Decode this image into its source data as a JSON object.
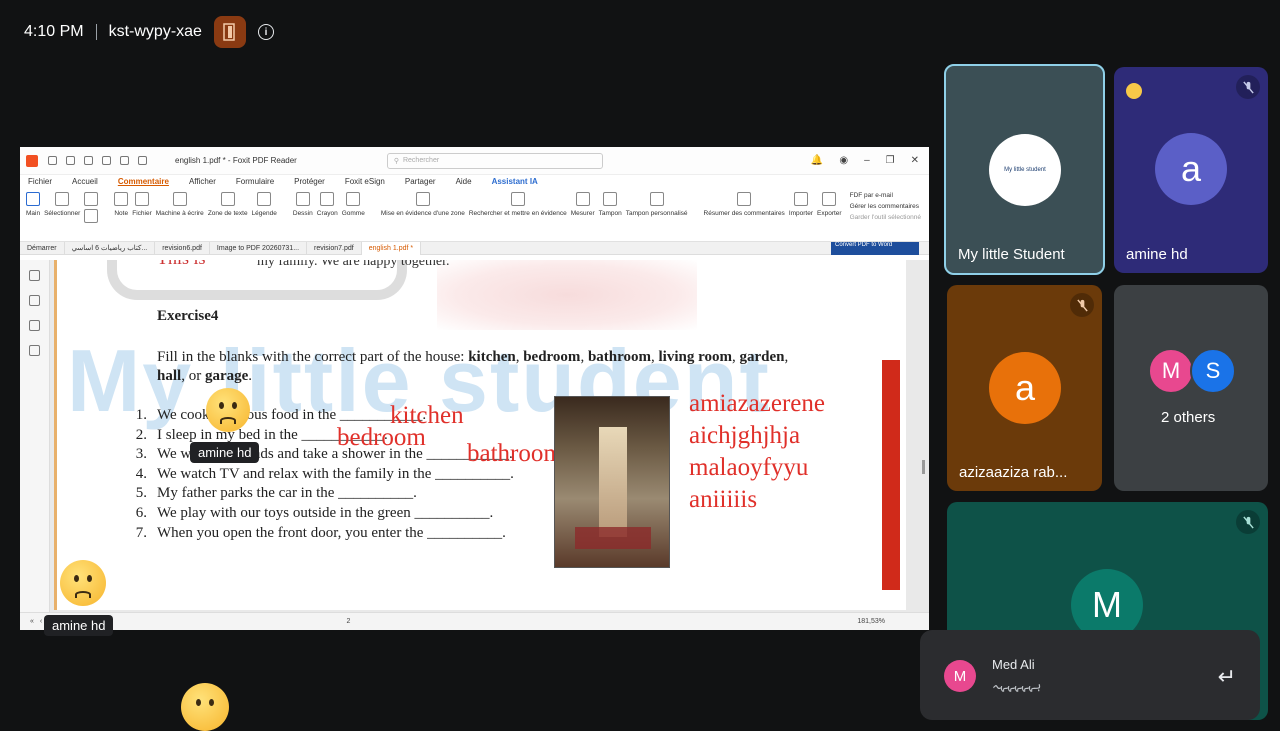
{
  "topbar": {
    "time": "4:10 PM",
    "meeting_code": "kst-wypy-xae",
    "door_icon": "door-icon",
    "info_icon": "info-icon"
  },
  "pdf_app": {
    "window_title": "english 1.pdf * - Foxit PDF Reader",
    "search_placeholder": "Rechercher",
    "menu": [
      "Fichier",
      "Accueil",
      "Commentaire",
      "Afficher",
      "Formulaire",
      "Protéger",
      "Foxit eSign",
      "Partager",
      "Aide",
      "Assistant IA"
    ],
    "active_menu": "Commentaire",
    "ribbon": {
      "main": "Main",
      "select": "Sélectionner",
      "note": "Note",
      "file": "Fichier",
      "typewriter": "Machine à écrire",
      "textbox": "Zone de texte",
      "legend": "Légende",
      "draw": "Dessin",
      "pencil": "Crayon",
      "eraser": "Gomme",
      "highlight_area": "Mise en évidence d'une zone",
      "search_highlight": "Rechercher et mettre en évidence",
      "measure": "Mesurer",
      "stamp": "Tampon",
      "custom_stamp": "Tampon personnalisé",
      "summarize": "Résumer des commentaires",
      "import": "Importer",
      "export": "Exporter",
      "fdf_email": "FDF par e-mail",
      "manage_comments": "Gérer les commentaires",
      "keep_tool": "Garder l'outil sélectionné"
    },
    "tabs": [
      "Démarrer",
      "كتاب رياضيات 6 اساسي...",
      "revision6.pdf",
      "Image to PDF 20260731...",
      "revision7.pdf",
      "english 1.pdf *"
    ],
    "current_tab": "english 1.pdf *",
    "convert_button": "Convert PDF to Word",
    "zoom": "181,53%",
    "page_number": "2"
  },
  "document": {
    "cut_line": "This is",
    "cut_line_rest": "my family. We are happy together.",
    "watermark": "My little student",
    "exercise_title": "Exercise4",
    "instructions_plain": "Fill in the blanks with the correct part of the house: ",
    "instructions_bold": [
      "kitchen",
      "bedroom",
      "bathroom",
      "living room",
      "garden",
      "hall"
    ],
    "instructions_tail_or": "or",
    "instructions_last": "garage",
    "items": [
      {
        "n": "1.",
        "text": "We cook delicious food in the ___________."
      },
      {
        "n": "2.",
        "text": "I sleep in my bed in the ___________."
      },
      {
        "n": "3.",
        "text": "We wash our hands and take a shower in the ___________."
      },
      {
        "n": "4.",
        "text": "We watch TV and relax with the family in the __________."
      },
      {
        "n": "5.",
        "text": "My father parks the car in the __________."
      },
      {
        "n": "6.",
        "text": "We play with our toys outside in the green __________."
      },
      {
        "n": "7.",
        "text": "When you open the front door, you enter the __________."
      }
    ],
    "answers": [
      "kitchen",
      "bedroom",
      "bathroom"
    ],
    "scribbles": [
      "amiazazerene",
      "aichjghjhja",
      "malaoyfyyu",
      "aniiiiis"
    ]
  },
  "reactions": {
    "tooltip_name_1": "amine hd",
    "tooltip_name_2": "amine hd"
  },
  "participants": [
    {
      "name": "My little Student",
      "avatar_text": "My little student",
      "color": "#3b4f55",
      "muted": false
    },
    {
      "name": "amine hd",
      "avatar_letter": "a",
      "color": "#5b5fc7",
      "muted": true
    },
    {
      "name": "azizaaziza rab...",
      "avatar_letter": "a",
      "color": "#e8710a",
      "muted": true
    },
    {
      "name": "2 others",
      "avatar_letters": [
        "M",
        "S"
      ]
    },
    {
      "name": "",
      "avatar_letter": "M",
      "color": "#0e5248",
      "muted": true
    }
  ],
  "chat_toast": {
    "avatar_letter": "M",
    "sender": "Med Ali",
    "message": "ہہہہہہہ",
    "reply_icon": "reply-icon"
  }
}
